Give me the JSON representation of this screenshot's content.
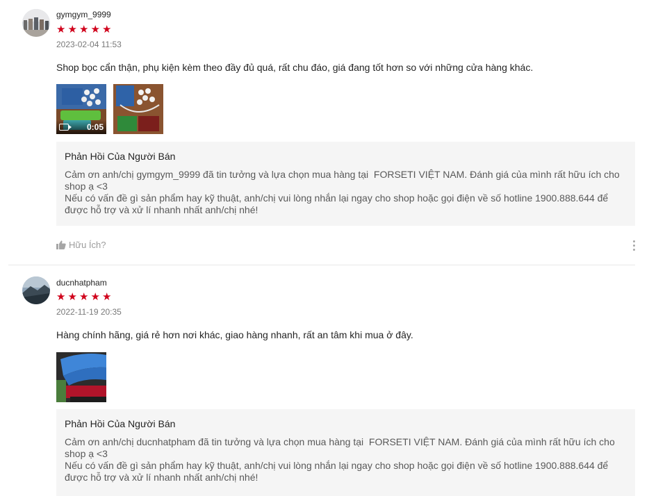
{
  "reviews": [
    {
      "username": "gymgym_9999",
      "rating": 5,
      "stars": [
        "★",
        "★",
        "★",
        "★",
        "★"
      ],
      "date": "2023-02-04 11:53",
      "content": "Shop bọc cẩn thận, phụ kiện kèm theo đầy đủ quá, rất chu đáo, giá đang tốt hơn so với những cửa hàng khác.",
      "video_duration": "0:05",
      "reply_title": "Phản Hồi Của Người Bán",
      "reply_text": "Cảm ơn anh/chị gymgym_9999 đã tin tưởng và lựa chọn mua hàng tại  FORSETI VIỆT NAM. Đánh giá của mình rất hữu ích cho shop ạ <3\nNếu có vấn đề gì sản phẩm hay kỹ thuật, anh/chị vui lòng nhắn lại ngay cho shop hoặc gọi điện về số hotline 1900.888.644 để được hỗ trợ và xử lí nhanh nhất anh/chị nhé!",
      "helpful_label": "Hữu Ích?"
    },
    {
      "username": "ducnhatpham",
      "rating": 5,
      "stars": [
        "★",
        "★",
        "★",
        "★",
        "★"
      ],
      "date": "2022-11-19 20:35",
      "content": "Hàng chính hãng, giá rẻ hơn nơi khác, giao hàng nhanh, rất an tâm khi mua ở đây.",
      "reply_title": "Phản Hồi Của Người Bán",
      "reply_text": "Cảm ơn anh/chị ducnhatpham đã tin tưởng và lựa chọn mua hàng tại  FORSETI VIỆT NAM. Đánh giá của mình rất hữu ích cho shop ạ <3\nNếu có vấn đề gì sản phẩm hay kỹ thuật, anh/chị vui lòng nhắn lại ngay cho shop hoặc gọi điện về số hotline 1900.888.644 để được hỗ trợ và xử lí nhanh nhất anh/chị nhé!"
    }
  ],
  "colors": {
    "star": "#d0011b",
    "reply_bg": "#f5f5f5"
  },
  "icons": {
    "helpful": "thumbs-up-icon",
    "more": "more-vertical-icon",
    "video": "video-camera-icon"
  }
}
